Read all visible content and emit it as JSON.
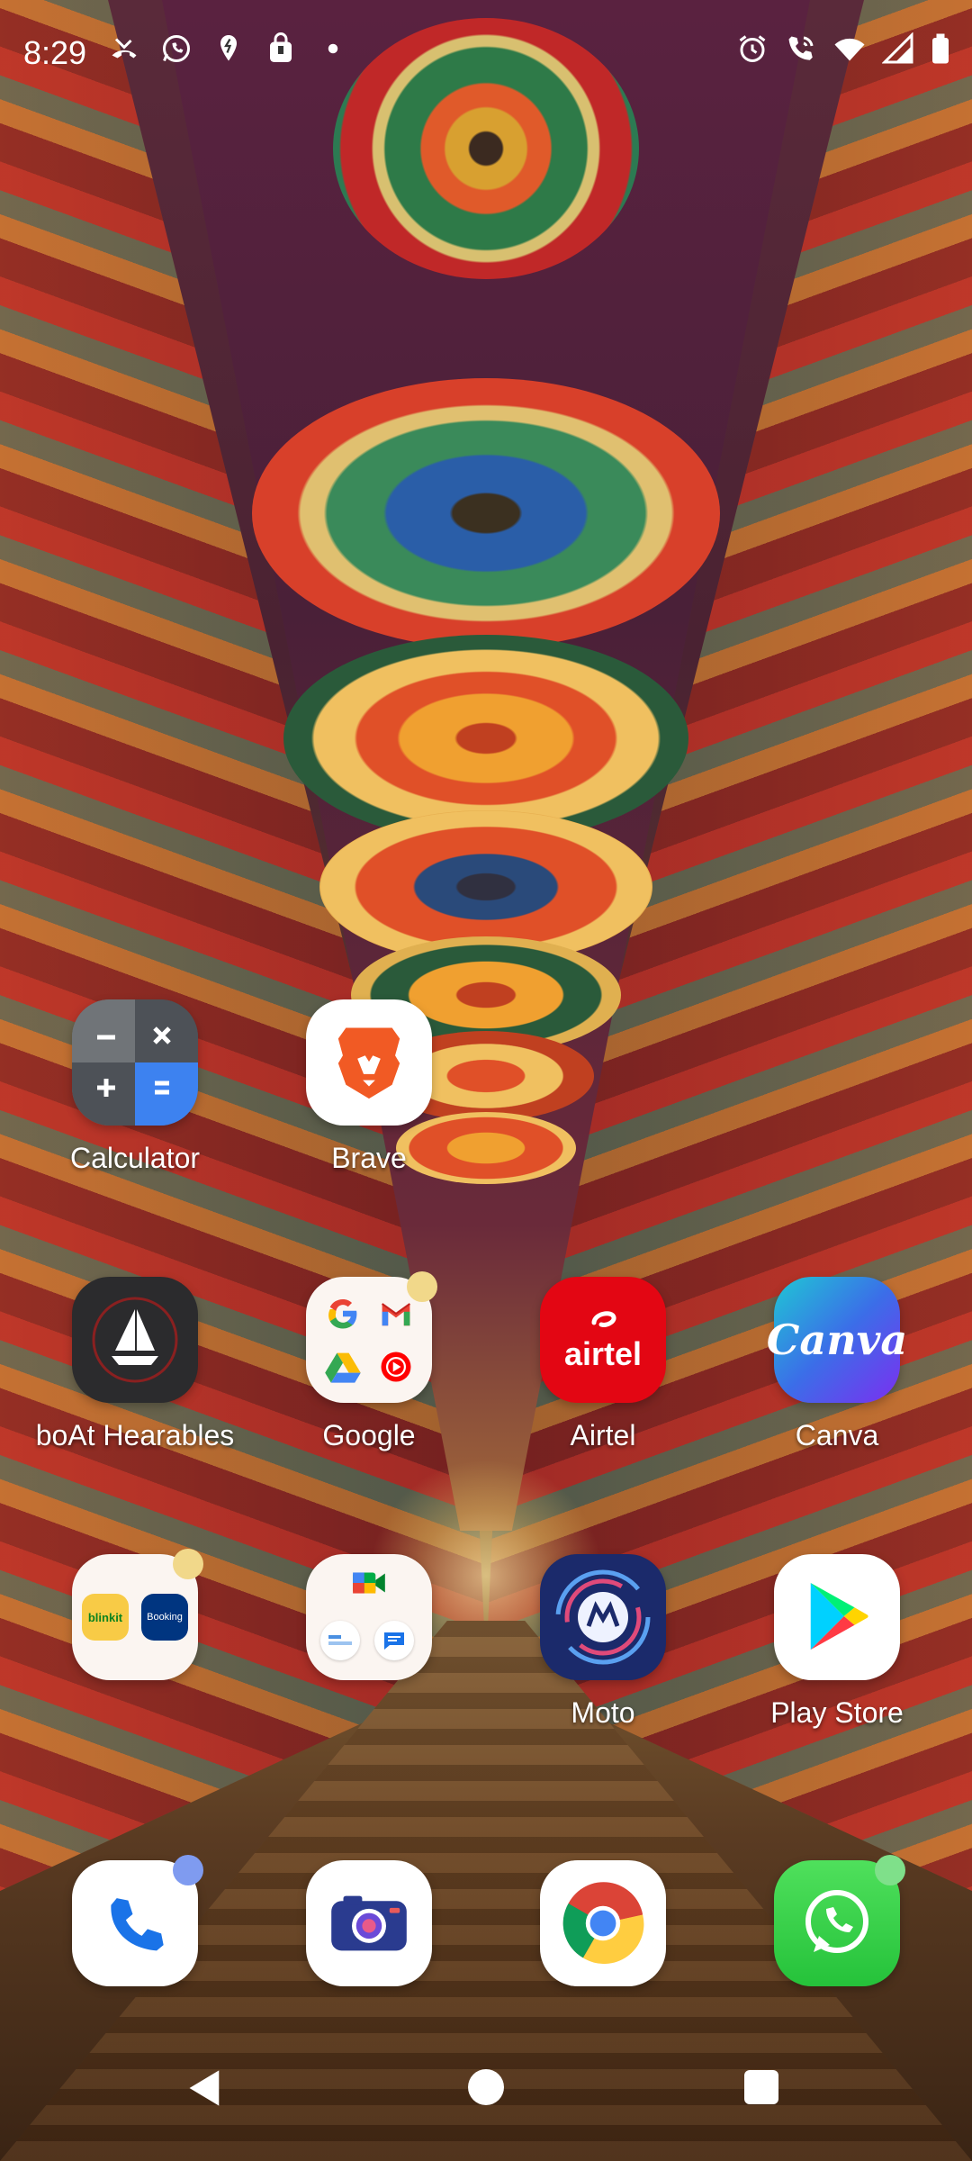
{
  "status_bar": {
    "time": "8:29",
    "left_icons": [
      "missed-call-icon",
      "whatsapp-icon",
      "location-icon",
      "bag-icon",
      "dot-icon"
    ],
    "right_icons": [
      "alarm-icon",
      "wifi-call-icon",
      "wifi-icon",
      "signal-icon",
      "battery-icon"
    ]
  },
  "apps": {
    "calculator": {
      "label": "Calculator"
    },
    "brave": {
      "label": "Brave"
    },
    "boat": {
      "label": "boAt Hearables"
    },
    "google": {
      "label": "Google",
      "badge_color": "#f1d88a"
    },
    "airtel": {
      "label": "Airtel",
      "icon_text": "airtel"
    },
    "canva": {
      "label": "Canva",
      "icon_text": "Canva"
    },
    "folder_shopping": {
      "label": "",
      "items": [
        "blinkit",
        "Booking"
      ],
      "badge_color": "#f1d88a"
    },
    "folder_comms": {
      "label": ""
    },
    "moto": {
      "label": "Moto"
    },
    "play_store": {
      "label": "Play Store"
    }
  },
  "dock": {
    "phone": {
      "badge_color": "#7f9bf0"
    },
    "camera": {},
    "chrome": {},
    "whatsapp": {
      "badge_color": "#7fe08a"
    }
  },
  "nav": {
    "buttons": [
      "back",
      "home",
      "recents"
    ]
  }
}
